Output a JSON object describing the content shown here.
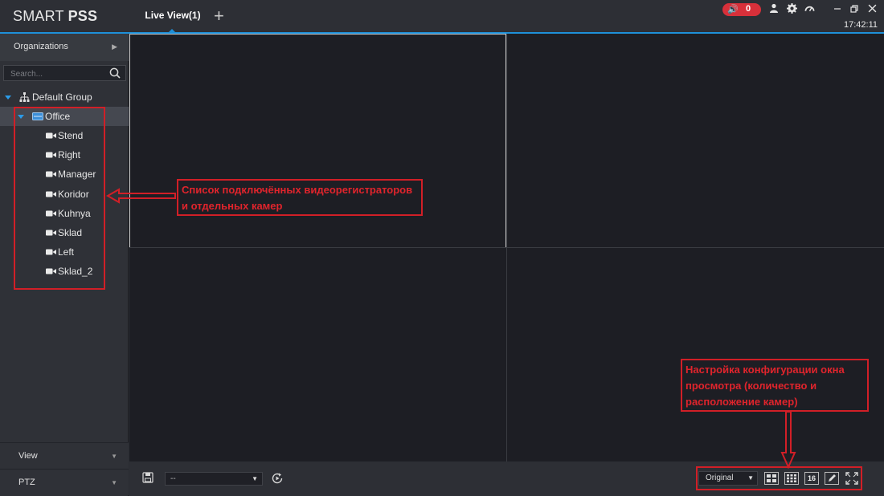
{
  "app": {
    "logo_light": "SMART ",
    "logo_bold": "PSS"
  },
  "tabs": [
    {
      "label": "Live View(1)"
    }
  ],
  "header": {
    "add_tab": "+",
    "alarm_count": "0",
    "clock": "17:42:11",
    "icons": [
      "speaker-icon",
      "user-icon",
      "gear-icon",
      "gauge-icon",
      "minimize-icon",
      "restore-icon",
      "close-icon"
    ]
  },
  "sidebar": {
    "organizations_label": "Organizations",
    "search_placeholder": "Search...",
    "group": "Default Group",
    "device": "Office",
    "cameras": [
      "Stend",
      "Right",
      "Manager",
      "Koridor",
      "Kuhnya",
      "Sklad",
      "Left",
      "Sklad_2"
    ],
    "bottom": [
      {
        "label": "View"
      },
      {
        "label": "PTZ"
      }
    ]
  },
  "toolbar": {
    "view_select": "--",
    "window_mode": "Original",
    "layout_16": "16"
  },
  "annotations": {
    "left": "Список подключённых видеорегистраторов и отдельных камер",
    "right": "Настройка конфигурации окна просмотра (количество и расположение камер)"
  },
  "colors": {
    "accent": "#1e90d8",
    "annotation": "#d11f27",
    "alarm": "#d7303a"
  }
}
